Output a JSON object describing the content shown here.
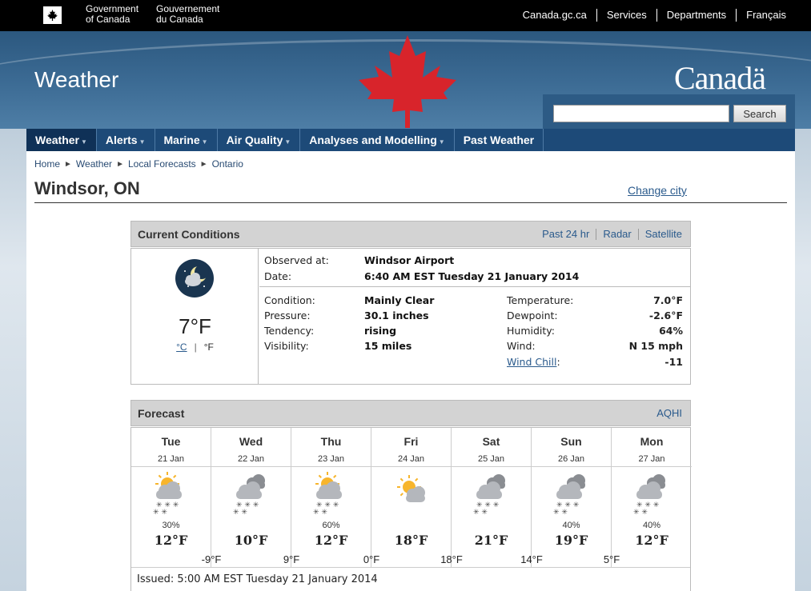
{
  "fip": {
    "gov_en": [
      "Government",
      "of Canada"
    ],
    "gov_fr": [
      "Gouvernement",
      "du Canada"
    ],
    "links": [
      "Canada.gc.ca",
      "Services",
      "Departments",
      "Français"
    ]
  },
  "banner": {
    "site_title": "Weather",
    "wordmark": "Canadä",
    "search_placeholder": "",
    "search_button": "Search"
  },
  "nav": {
    "items": [
      {
        "label": "Weather",
        "active": true,
        "caret": true
      },
      {
        "label": "Alerts",
        "caret": true
      },
      {
        "label": "Marine",
        "caret": true
      },
      {
        "label": "Air Quality",
        "caret": true
      },
      {
        "label": "Analyses and Modelling",
        "caret": true
      },
      {
        "label": "Past Weather",
        "caret": false
      }
    ]
  },
  "breadcrumb": [
    "Home",
    "Weather",
    "Local Forecasts",
    "Ontario"
  ],
  "page": {
    "title": "Windsor, ON",
    "change_city": "Change city"
  },
  "current": {
    "heading": "Current Conditions",
    "links": [
      "Past 24 hr",
      "Radar",
      "Satellite"
    ],
    "icon": "clear-night-icon",
    "temp": "7°F",
    "unit_c": "°C",
    "unit_f": "°F",
    "observed_label": "Observed at:",
    "observed_value": "Windsor Airport",
    "date_label": "Date:",
    "date_value": "6:40 AM EST Tuesday 21 January 2014",
    "condition_label": "Condition:",
    "condition_value": "Mainly Clear",
    "pressure_label": "Pressure:",
    "pressure_value": "30.1 inches",
    "tendency_label": "Tendency:",
    "tendency_value": "rising",
    "visibility_label": "Visibility:",
    "visibility_value": "15 miles",
    "temperature_label": "Temperature:",
    "temperature_value": "7.0°F",
    "dewpoint_label": "Dewpoint:",
    "dewpoint_value": "-2.6°F",
    "humidity_label": "Humidity:",
    "humidity_value": "64%",
    "wind_label": "Wind:",
    "wind_value": "N 15 mph",
    "windchill_label": "Wind Chill",
    "windchill_colon": ":",
    "windchill_value": "-11"
  },
  "forecast": {
    "heading": "Forecast",
    "aqhi": "AQHI",
    "days": [
      {
        "name": "Tue",
        "date": "21 Jan",
        "icon": "sun-cloud-snow-icon",
        "pop": "30%",
        "high": "12°F"
      },
      {
        "name": "Wed",
        "date": "22 Jan",
        "icon": "cloud-snow-icon",
        "pop": "",
        "high": "10°F"
      },
      {
        "name": "Thu",
        "date": "23 Jan",
        "icon": "sun-cloud-snow-icon",
        "pop": "60%",
        "high": "12°F"
      },
      {
        "name": "Fri",
        "date": "24 Jan",
        "icon": "sun-cloud-icon",
        "pop": "",
        "high": "18°F"
      },
      {
        "name": "Sat",
        "date": "25 Jan",
        "icon": "cloud-snow-icon",
        "pop": "",
        "high": "21°F"
      },
      {
        "name": "Sun",
        "date": "26 Jan",
        "icon": "cloud-snow-icon",
        "pop": "40%",
        "high": "19°F"
      },
      {
        "name": "Mon",
        "date": "27 Jan",
        "icon": "cloud-snow-icon",
        "pop": "40%",
        "high": "12°F"
      }
    ],
    "night_lows": [
      "-9°F",
      "9°F",
      "0°F",
      "18°F",
      "14°F",
      "5°F"
    ],
    "issued": "Issued: 5:00 AM EST Tuesday 21 January 2014"
  },
  "colors": {
    "nav_bg": "#1d4a78",
    "nav_active": "#0f3157",
    "link": "#2a5a8c",
    "leaf_red": "#d8242b"
  }
}
